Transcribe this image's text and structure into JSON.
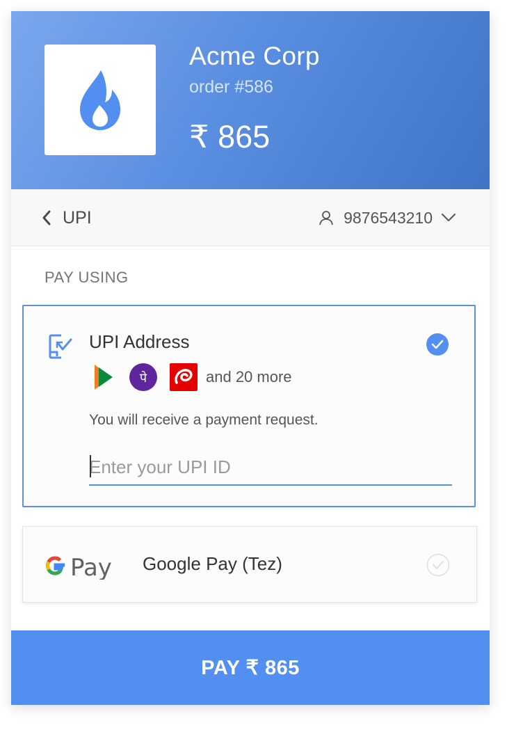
{
  "header": {
    "merchant_name": "Acme Corp",
    "order_id": "order #586",
    "amount": "₹ 865"
  },
  "topbar": {
    "back_label": "UPI",
    "contact_number": "9876543210"
  },
  "section": {
    "title": "PAY USING"
  },
  "upi_option": {
    "title": "UPI Address",
    "apps": [
      "bhim-logo",
      "phonepe-logo",
      "airtel-logo"
    ],
    "phonepe_glyph": "पे",
    "more_text": "and 20 more",
    "info": "You will receive a payment request.",
    "input_placeholder": "Enter your UPI ID",
    "input_value": "",
    "selected": true
  },
  "gpay_option": {
    "logo_text": "Pay",
    "label": "Google Pay (Tez)",
    "selected": false
  },
  "pay_button": {
    "label": "PAY ₹ 865"
  },
  "colors": {
    "accent": "#528ff0",
    "header_start": "#7aa7ee",
    "header_end": "#3f74c6",
    "phonepe": "#5f259f",
    "airtel": "#e40000"
  }
}
